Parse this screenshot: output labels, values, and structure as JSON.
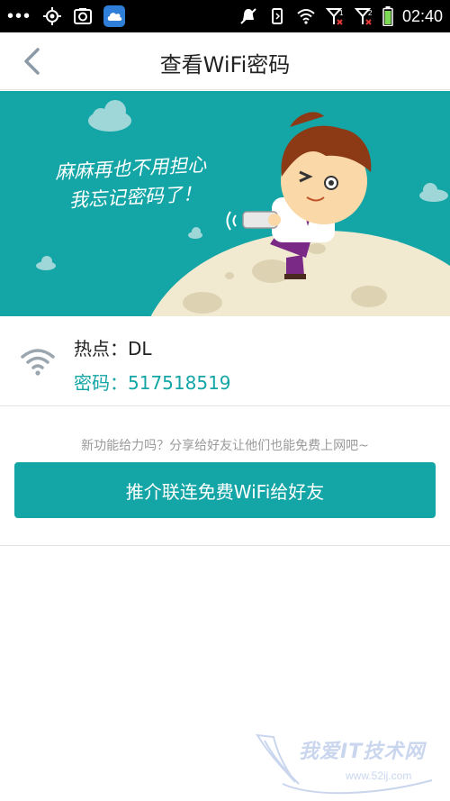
{
  "status_bar": {
    "time": "02:40",
    "icons": [
      "more-dots-icon",
      "gps-icon",
      "screenshot-icon",
      "cloud-app-icon",
      "mute-icon",
      "vibrate-icon",
      "wifi-signal-icon",
      "signal-1-icon",
      "signal-2-icon",
      "battery-icon"
    ]
  },
  "header": {
    "title": "查看WiFi密码",
    "back_icon": "chevron-left-icon"
  },
  "banner": {
    "slogan_line1": "麻麻再也不用担心",
    "slogan_line2": "我忘记密码了！",
    "colors": {
      "background": "#14a5a6",
      "moon": "#f1ead1"
    }
  },
  "hotspot": {
    "name_label": "热点：",
    "name": "DL",
    "password_label": "密码：",
    "password": "517518519",
    "icon": "wifi-icon"
  },
  "share": {
    "hint": "新功能给力吗？分享给好友让他们也能免费上网吧~",
    "button_label": "推介联连免费WiFi给好友"
  },
  "watermark": {
    "text": "我爱IT技术网",
    "url": "www.52ij.com"
  },
  "colors": {
    "accent": "#14a5a6",
    "text": "#222222",
    "hint": "#9a9a9a"
  }
}
